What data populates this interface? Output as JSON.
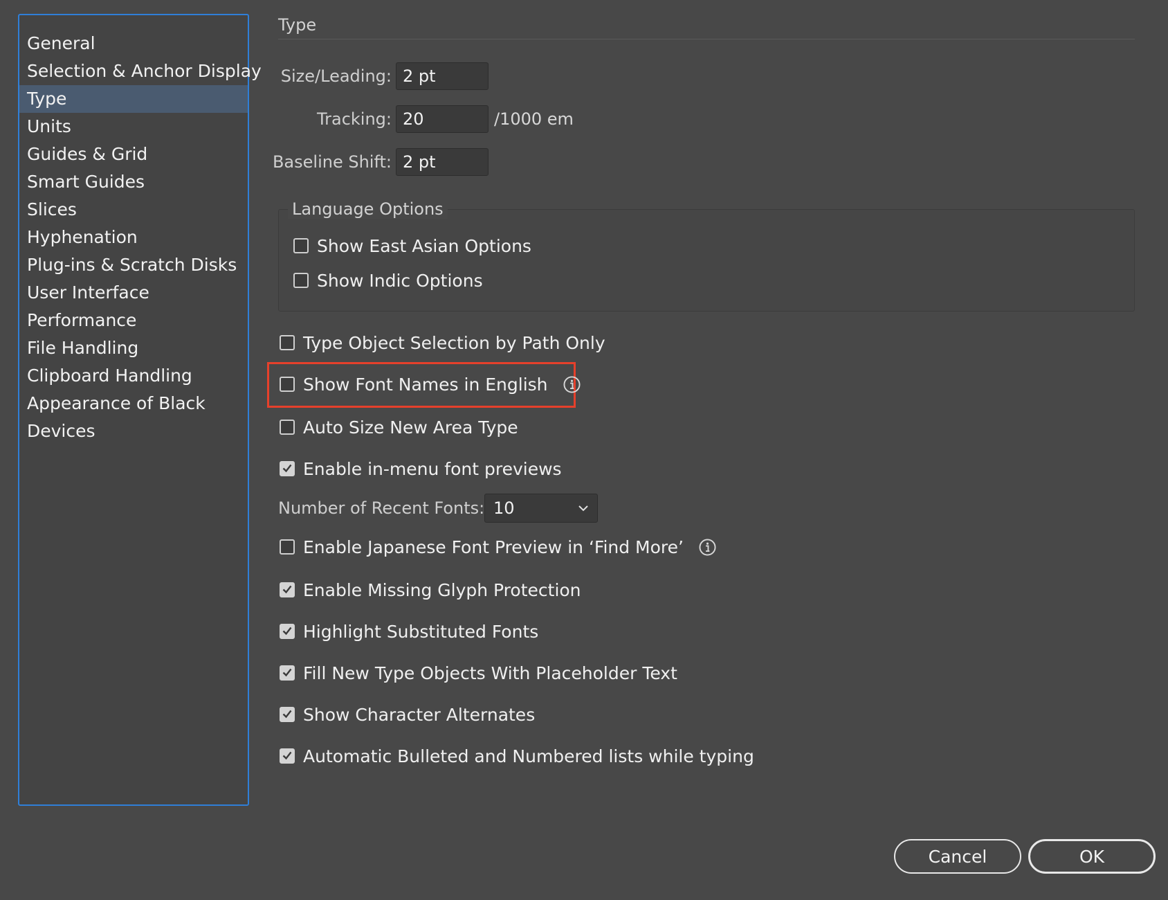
{
  "sidebar": {
    "items": [
      {
        "label": "General",
        "selected": false
      },
      {
        "label": "Selection & Anchor Display",
        "selected": false
      },
      {
        "label": "Type",
        "selected": true
      },
      {
        "label": "Units",
        "selected": false
      },
      {
        "label": "Guides & Grid",
        "selected": false
      },
      {
        "label": "Smart Guides",
        "selected": false
      },
      {
        "label": "Slices",
        "selected": false
      },
      {
        "label": "Hyphenation",
        "selected": false
      },
      {
        "label": "Plug-ins & Scratch Disks",
        "selected": false
      },
      {
        "label": "User Interface",
        "selected": false
      },
      {
        "label": "Performance",
        "selected": false
      },
      {
        "label": "File Handling",
        "selected": false
      },
      {
        "label": "Clipboard Handling",
        "selected": false
      },
      {
        "label": "Appearance of Black",
        "selected": false
      },
      {
        "label": "Devices",
        "selected": false
      }
    ]
  },
  "main": {
    "section_title": "Type",
    "size_leading": {
      "label": "Size/Leading:",
      "value": "2 pt"
    },
    "tracking": {
      "label": "Tracking:",
      "value": "20",
      "unit": "/1000 em"
    },
    "baseline_shift": {
      "label": "Baseline Shift:",
      "value": "2 pt"
    },
    "language_options": {
      "title": "Language Options",
      "options": [
        {
          "label": "Show East Asian Options",
          "checked": false
        },
        {
          "label": "Show Indic Options",
          "checked": false
        }
      ]
    },
    "options": {
      "type_object_selection": {
        "label": "Type Object Selection by Path Only",
        "checked": false
      },
      "font_names_english": {
        "label": "Show Font Names in English",
        "checked": false,
        "icon": "info-icon"
      },
      "auto_size_area_type": {
        "label": "Auto Size New Area Type",
        "checked": false
      },
      "in_menu_previews": {
        "label": "Enable in-menu font previews",
        "checked": true
      },
      "japanese_preview": {
        "label": "Enable Japanese Font Preview in ‘Find More’",
        "checked": false,
        "icon": "info-icon"
      },
      "missing_glyph": {
        "label": "Enable Missing Glyph Protection",
        "checked": true
      },
      "highlight_substituted": {
        "label": "Highlight Substituted Fonts",
        "checked": true
      },
      "placeholder_text": {
        "label": "Fill New Type Objects With Placeholder Text",
        "checked": true
      },
      "character_alternates": {
        "label": "Show Character Alternates",
        "checked": true
      },
      "auto_bullets": {
        "label": "Automatic Bulleted and Numbered lists while typing",
        "checked": true
      }
    },
    "recent_fonts": {
      "label": "Number of Recent Fonts:",
      "value": "10"
    }
  },
  "buttons": {
    "cancel": "Cancel",
    "ok": "OK"
  },
  "colors": {
    "background": "#484848",
    "sidebar_border": "#2f7fd8",
    "sidebar_selected": "#4a5b70",
    "highlight_outline": "#e6402b"
  }
}
